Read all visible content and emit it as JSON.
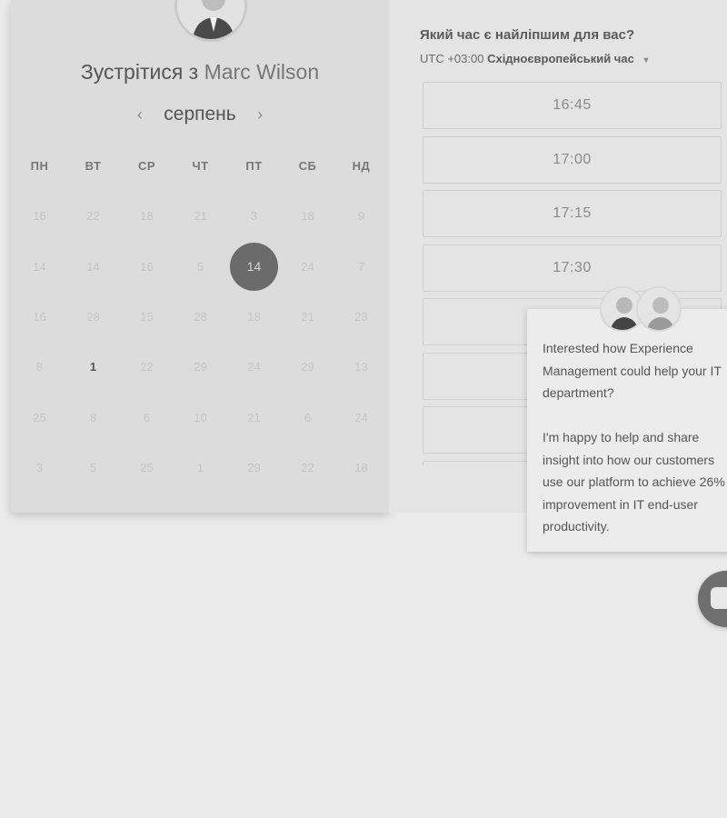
{
  "calendar": {
    "title_prefix": "Зустрітися з",
    "host_name": "Marc Wilson",
    "month": "серпень",
    "prev_icon": "chevron-left-icon",
    "next_icon": "chevron-right-icon",
    "weekdays": [
      "ПН",
      "ВТ",
      "СР",
      "ЧТ",
      "ПТ",
      "СБ",
      "НД"
    ],
    "weeks": [
      [
        "16",
        "22",
        "18",
        "21",
        "3",
        "18",
        "9"
      ],
      [
        "14",
        "14",
        "16",
        "5",
        "14",
        "24",
        "7"
      ],
      [
        "16",
        "28",
        "15",
        "28",
        "18",
        "21",
        "23"
      ],
      [
        "8",
        "1",
        "22",
        "29",
        "24",
        "29",
        "13"
      ],
      [
        "25",
        "8",
        "6",
        "10",
        "21",
        "6",
        "24"
      ],
      [
        "3",
        "5",
        "25",
        "1",
        "29",
        "22",
        "18"
      ]
    ],
    "selected": {
      "week": 1,
      "day": 4
    },
    "available": [
      {
        "week": 3,
        "day": 1
      }
    ]
  },
  "times": {
    "question": "Який час є найліпшим для вас?",
    "tz_prefix": "UTC +03:00",
    "tz_name": "Східноєвропейський час",
    "slots": [
      "16:45",
      "17:00",
      "17:15",
      "17:30",
      "",
      "",
      "",
      ""
    ]
  },
  "chat": {
    "message": "Interested how Experience\nManagement could help your IT\ndepartment?\n\nI'm happy to help and share\ninsight into how our customers\nuse our platform to achieve 26%\nimprovement in IT end-user\nproductivity.",
    "launcher_icon": "chat-bubble-icon"
  },
  "colors": {
    "overlay_tint": "#ebebeb",
    "selected_day": "#6b6b6b"
  }
}
